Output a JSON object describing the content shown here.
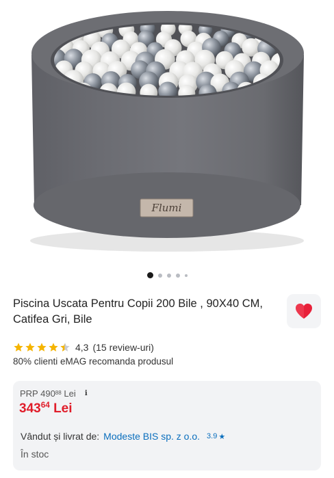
{
  "product": {
    "title": "Piscina Uscata Pentru Copii 200 Bile , 90X40 CM, Catifea Gri, Bile",
    "brand_label": "Flumi",
    "image_count": 5,
    "active_image_index": 0
  },
  "rating": {
    "value": "4,3",
    "stars": 4.3,
    "count_text": "(15 review-uri)",
    "recommendation": "80% clienti eMAG recomanda produsul"
  },
  "pricing": {
    "prp_label": "PRP 490",
    "prp_decimals": "88",
    "prp_currency": "Lei",
    "info_icon": "i",
    "price_main": "343",
    "price_decimals": "64",
    "price_currency": "Lei"
  },
  "seller": {
    "label": "Vândut și livrat de:",
    "name": "Modeste BIS sp. z o.o.",
    "score": "3.9",
    "score_icon": "★"
  },
  "stock": {
    "text": "În stoc"
  },
  "icons": {
    "favorite": "heart-icon",
    "info": "info-icon",
    "star": "star-icon"
  },
  "colors": {
    "price_red": "#e01d2a",
    "link_blue": "#0a6ebd",
    "star_yellow": "#f5b400",
    "heart_red": "#e8213a"
  }
}
